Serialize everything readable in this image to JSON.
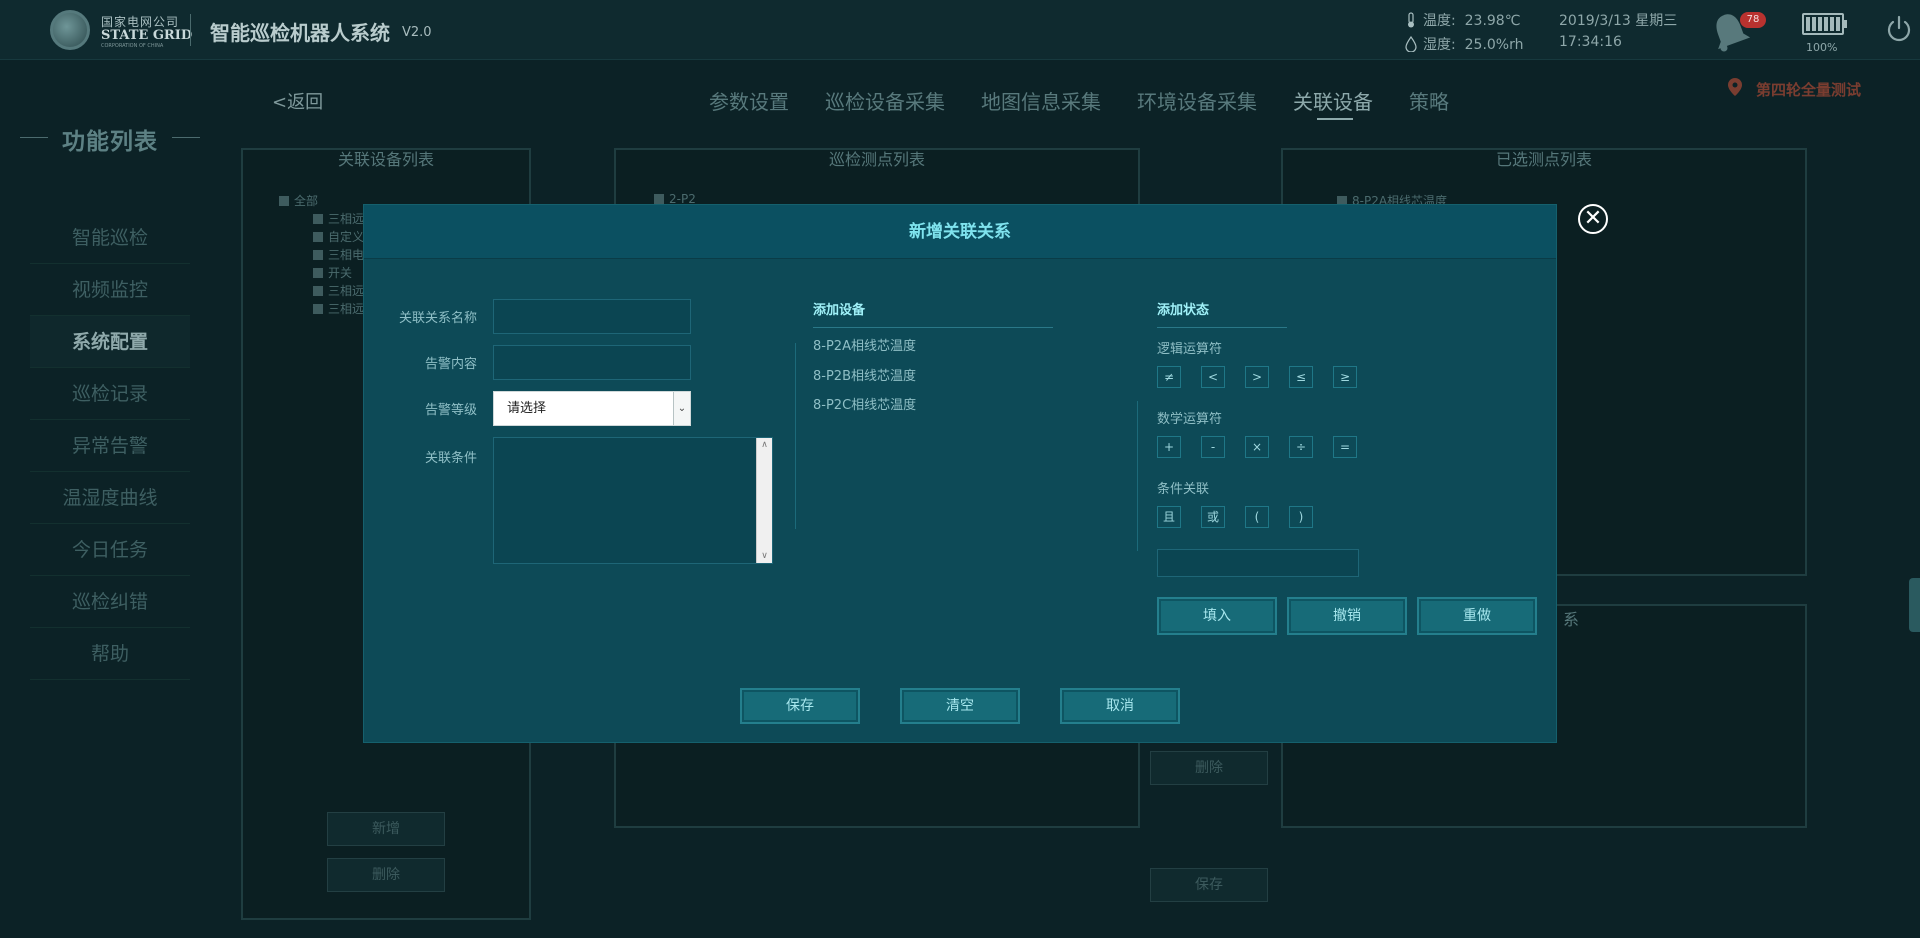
{
  "header": {
    "logo_cn": "国家电网公司",
    "logo_en": "STATE GRID",
    "logo_sub": "CORPORATION OF CHINA",
    "system_title": "智能巡检机器人系统",
    "version": "V2.0",
    "temperature_label": "温度:",
    "temperature_value": "23.98℃",
    "humidity_label": "湿度:",
    "humidity_value": "25.0%rh",
    "date": "2019/3/13 星期三",
    "time": "17:34:16",
    "alarm_count": "78",
    "battery_pct": "100%",
    "battery_level": 1.0
  },
  "sidebar": {
    "title": "功能列表",
    "items": [
      {
        "label": "智能巡检"
      },
      {
        "label": "视频监控"
      },
      {
        "label": "系统配置"
      },
      {
        "label": "巡检记录"
      },
      {
        "label": "异常告警"
      },
      {
        "label": "温湿度曲线"
      },
      {
        "label": "今日任务"
      },
      {
        "label": "巡检纠错"
      },
      {
        "label": "帮助"
      }
    ]
  },
  "main": {
    "back": "<返回",
    "tabs": [
      {
        "label": "参数设置"
      },
      {
        "label": "巡检设备采集"
      },
      {
        "label": "地图信息采集"
      },
      {
        "label": "环境设备采集"
      },
      {
        "label": "关联设备"
      },
      {
        "label": "策略"
      }
    ],
    "location": "第四轮全量测试",
    "panel_left_title": "关联设备列表",
    "panel_mid_title": "巡检测点列表",
    "panel_right_title": "已选测点列表",
    "panel_right2_title": "系",
    "tree_root": "全部",
    "tree_children": [
      "三相远",
      "自定义",
      "三相电",
      "开关",
      "三相远",
      "三相远"
    ],
    "mid_tree_root": "2-P2",
    "right_list_item": "8-P2A相线芯温度",
    "left_btn_add": "新增",
    "left_btn_delete": "删除",
    "mid_btn_delete": "删除",
    "mid_btn_save": "保存"
  },
  "modal": {
    "title": "新增关联关系",
    "close_icon": "close-circle-icon",
    "form": {
      "name_label": "关联关系名称",
      "name_value": "",
      "alarm_content_label": "告警内容",
      "alarm_content_value": "",
      "alarm_level_label": "告警等级",
      "alarm_level_selected": "请选择",
      "condition_label": "关联条件",
      "condition_value": ""
    },
    "devices": {
      "title": "添加设备",
      "items": [
        "8-P2A相线芯温度",
        "8-P2B相线芯温度",
        "8-P2C相线芯温度"
      ]
    },
    "status": {
      "title": "添加状态",
      "logic_label": "逻辑运算符",
      "logic_ops": [
        "≠",
        "<",
        ">",
        "≤",
        "≥"
      ],
      "math_label": "数学运算符",
      "math_ops": [
        "+",
        "-",
        "×",
        "÷",
        "="
      ],
      "cond_label": "条件关联",
      "cond_ops": [
        "且",
        "或",
        "(",
        ")"
      ],
      "input_value": "",
      "fill_btn": "填入",
      "undo_btn": "撤销",
      "redo_btn": "重做"
    },
    "footer": {
      "save": "保存",
      "clear": "清空",
      "cancel": "取消"
    }
  }
}
